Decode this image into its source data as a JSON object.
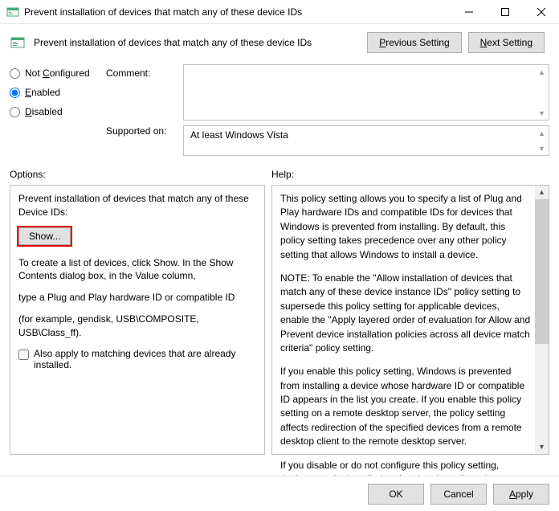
{
  "titlebar": {
    "title": "Prevent installation of devices that match any of these device IDs"
  },
  "header": {
    "heading": "Prevent installation of devices that match any of these device IDs",
    "previous": "Previous Setting",
    "next": "Next Setting"
  },
  "radios": {
    "not_configured": "Not Configured",
    "enabled": "Enabled",
    "disabled": "Disabled",
    "selected": "enabled"
  },
  "labels": {
    "comment": "Comment:",
    "supported": "Supported on:",
    "options": "Options:",
    "help": "Help:"
  },
  "comment_value": "",
  "supported_value": "At least Windows Vista",
  "options": {
    "p1": "Prevent installation of devices that match any of these Device IDs:",
    "show_btn": "Show...",
    "p2": "To create a list of devices, click Show. In the Show Contents dialog box, in the Value column,",
    "p3": "type a Plug and Play hardware ID or compatible ID",
    "p4": "(for example, gendisk, USB\\COMPOSITE, USB\\Class_ff).",
    "chk_label": "Also apply to matching devices that are already installed."
  },
  "help": {
    "p1": "This policy setting allows you to specify a list of Plug and Play hardware IDs and compatible IDs for devices that Windows is prevented from installing. By default, this policy setting takes precedence over any other policy setting that allows Windows to install a device.",
    "p2": "NOTE: To enable the \"Allow installation of devices that match any of these device instance IDs\" policy setting to supersede this policy setting for applicable devices, enable the \"Apply layered order of evaluation for Allow and Prevent device installation policies across all device match criteria\" policy setting.",
    "p3": "If you enable this policy setting, Windows is prevented from installing a device whose hardware ID or compatible ID appears in the list you create. If you enable this policy setting on a remote desktop server, the policy setting affects redirection of the specified devices from a remote desktop client to the remote desktop server.",
    "p4": "If you disable or do not configure this policy setting, devices can be installed and updated as allowed or prevented by other policy"
  },
  "footer": {
    "ok": "OK",
    "cancel": "Cancel",
    "apply": "Apply"
  }
}
